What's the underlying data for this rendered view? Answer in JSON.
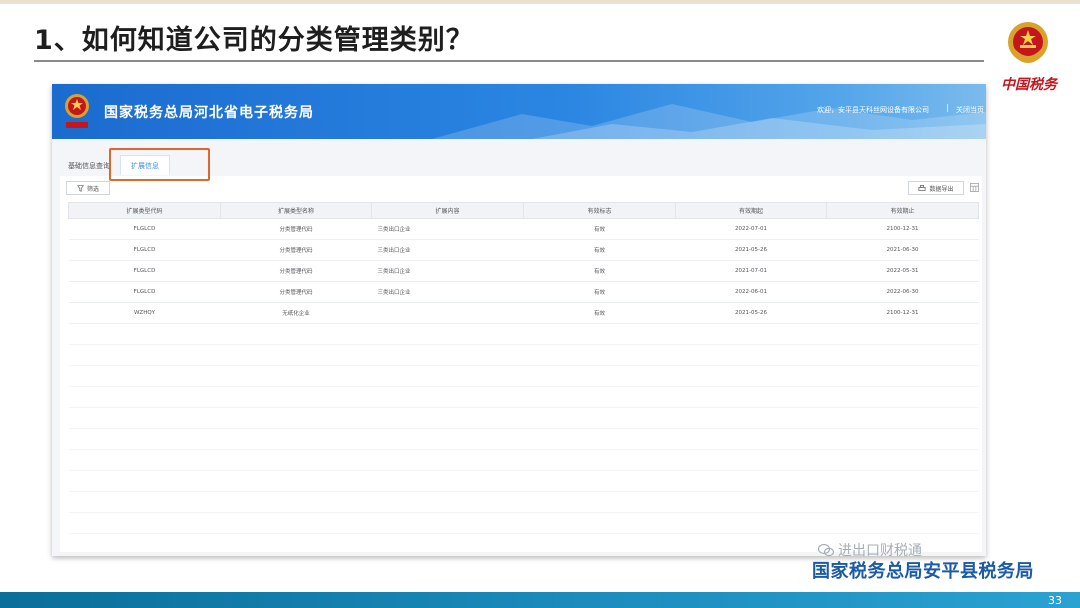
{
  "slide": {
    "title": "1、如何知道公司的分类管理类别？",
    "brand": "中国税务",
    "page_number": "33"
  },
  "site": {
    "title": "国家税务总局河北省电子税务局",
    "user_info": "欢迎，安平县天科丝网设备有限公司",
    "separator": "|",
    "close": "关闭当页"
  },
  "tabs": [
    {
      "label": "基础信息查询",
      "active": false
    },
    {
      "label": "扩展信息",
      "active": true
    }
  ],
  "toolbar": {
    "filter_label": "筛选",
    "export_label": "数据导出"
  },
  "table": {
    "columns": [
      "扩展类型代码",
      "扩展类型名称",
      "扩展内容",
      "有效标志",
      "有效期起",
      "有效期止"
    ],
    "rows": [
      [
        "FLGLCD",
        "分类管理代码",
        "三类出口企业",
        "有效",
        "2022-07-01",
        "2100-12-31"
      ],
      [
        "FLGLCD",
        "分类管理代码",
        "三类出口企业",
        "有效",
        "2021-05-26",
        "2021-06-30"
      ],
      [
        "FLGLCD",
        "分类管理代码",
        "三类出口企业",
        "有效",
        "2021-07-01",
        "2022-05-31"
      ],
      [
        "FLGLCD",
        "分类管理代码",
        "三类出口企业",
        "有效",
        "2022-06-01",
        "2022-06-30"
      ],
      [
        "WZHQY",
        "无纸化企业",
        "",
        "有效",
        "2021-05-26",
        "2100-12-31"
      ]
    ]
  },
  "footer": {
    "watermark": "进出口财税通",
    "bureau": "国家税务总局安平县税务局"
  },
  "colors": {
    "header_blue": "#2b86e2",
    "highlight_orange": "#e0672c",
    "bureau_blue": "#1b5aa6",
    "brand_red": "#c4161c"
  }
}
